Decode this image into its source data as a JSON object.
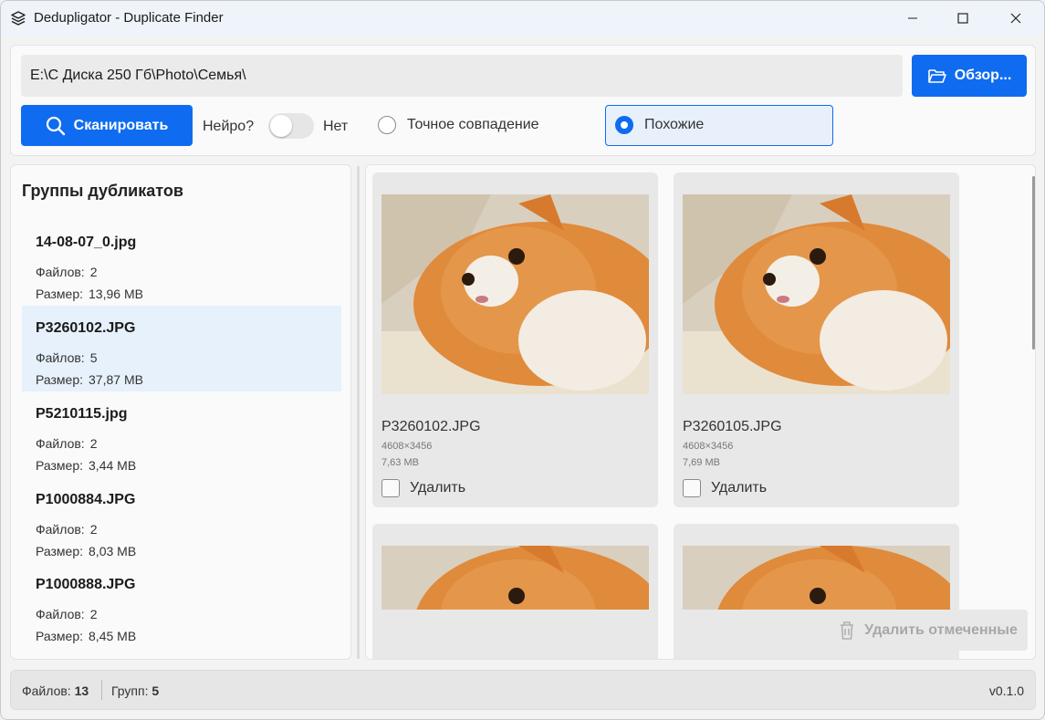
{
  "window": {
    "title": "Dedupligator - Duplicate Finder",
    "minimize_icon": "minimize-icon",
    "maximize_icon": "maximize-icon",
    "close_icon": "close-icon"
  },
  "toolbar": {
    "path_value": "E:\\С Диска 250 Гб\\Photo\\Семья\\",
    "browse_label": "Обзор...",
    "scan_label": "Сканировать",
    "neuro_label": "Нейро?",
    "neuro_state": "Нет",
    "neuro_on": false,
    "mode_exact_label": "Точное совпадение",
    "mode_similar_label": "Похожие",
    "selected_mode": "similar",
    "accent_color": "#0f6cf0"
  },
  "groups_panel": {
    "title": "Группы дубликатов",
    "files_label": "Файлов:",
    "size_label": "Размер:",
    "items": [
      {
        "name": "14-08-07_0.jpg",
        "files": "2",
        "size": "13,96 MB",
        "selected": false
      },
      {
        "name": "P3260102.JPG",
        "files": "5",
        "size": "37,87 MB",
        "selected": true
      },
      {
        "name": "P5210115.jpg",
        "files": "2",
        "size": "3,44 MB",
        "selected": false
      },
      {
        "name": "P1000884.JPG",
        "files": "2",
        "size": "8,03 MB",
        "selected": false
      },
      {
        "name": "P1000888.JPG",
        "files": "2",
        "size": "8,45 MB",
        "selected": false
      }
    ]
  },
  "files_panel": {
    "delete_label": "Удалить",
    "delete_marked_label": "Удалить отмеченные",
    "cards": [
      {
        "name": "P3260102.JPG",
        "dims": "4608×3456",
        "size": "7,63 MB"
      },
      {
        "name": "P3260105.JPG",
        "dims": "4608×3456",
        "size": "7,69 MB"
      },
      {
        "name": "",
        "dims": "",
        "size": ""
      },
      {
        "name": "",
        "dims": "",
        "size": ""
      }
    ]
  },
  "statusbar": {
    "files_label": "Файлов:",
    "files_value": "13",
    "groups_label": "Групп:",
    "groups_value": "5",
    "version": "v0.1.0"
  }
}
